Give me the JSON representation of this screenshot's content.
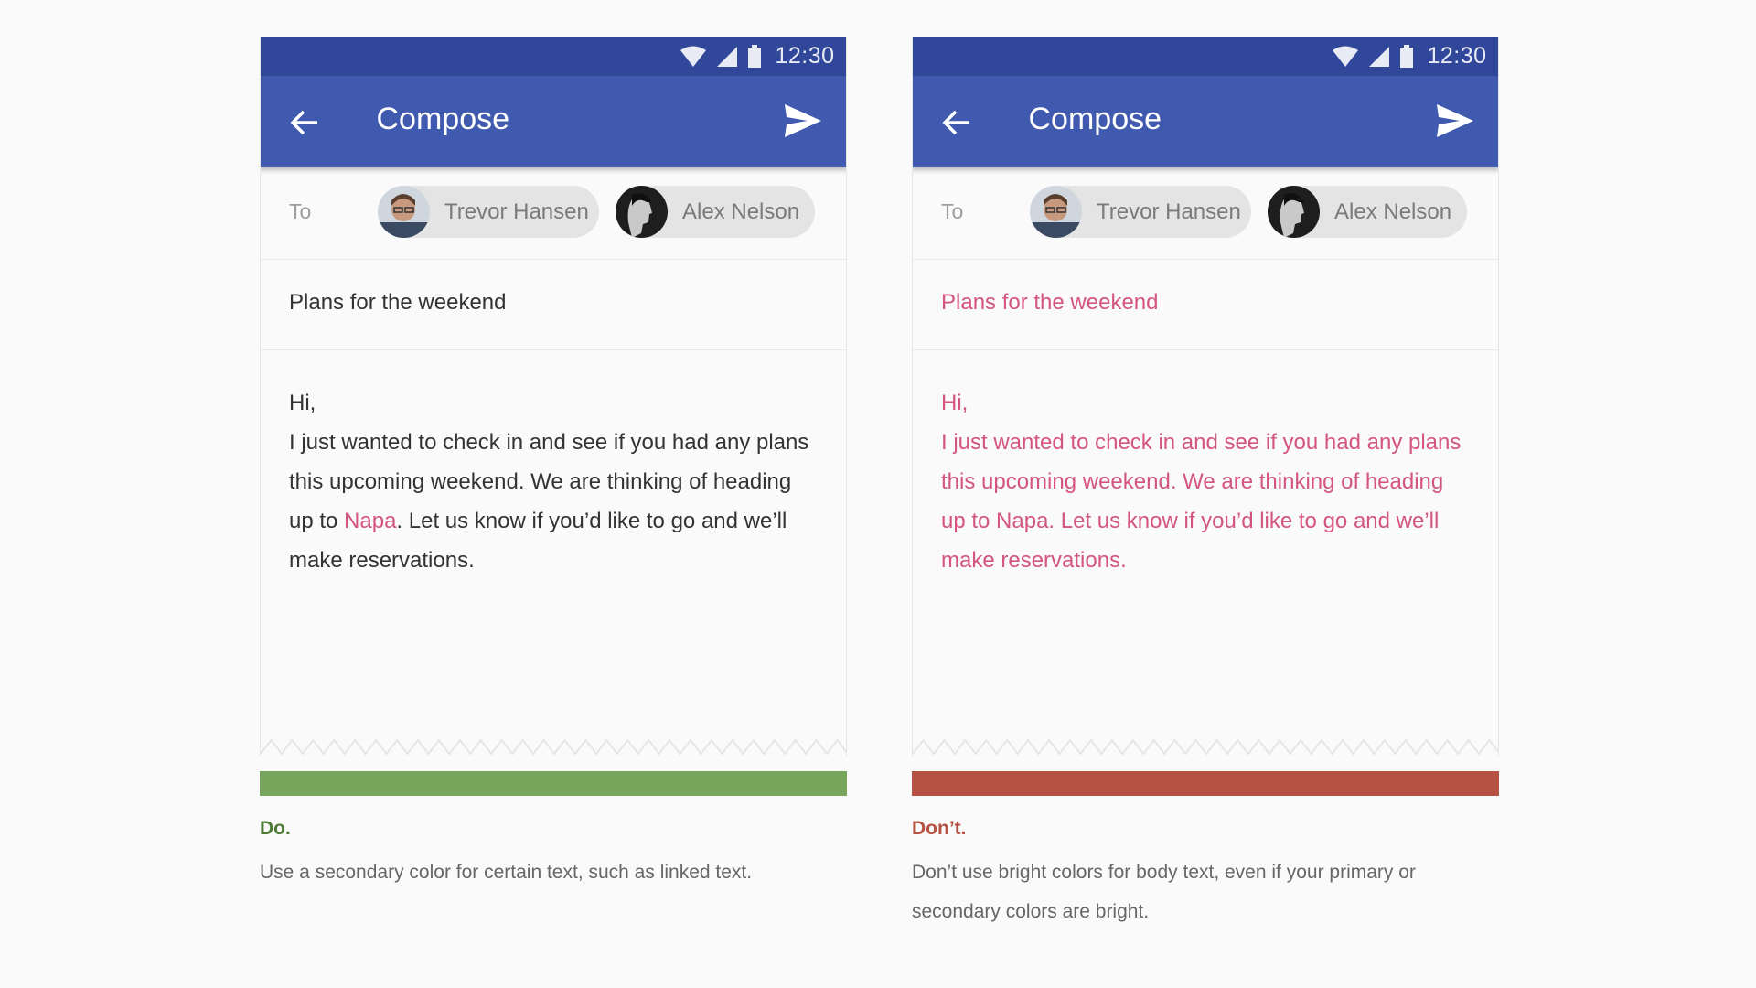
{
  "status_bar": {
    "time": "12:30",
    "icons": [
      "wifi-icon",
      "signal-icon",
      "battery-icon"
    ]
  },
  "app_bar": {
    "title": "Compose",
    "back_icon": "arrow-back-icon",
    "send_icon": "send-icon"
  },
  "compose": {
    "to_label": "To",
    "recipients": [
      {
        "name": "Trevor Hansen"
      },
      {
        "name": "Alex Nelson"
      }
    ],
    "subject": "Plans for the weekend",
    "body": {
      "greeting": "Hi,",
      "before_link": "I just wanted to check in and see if you had any plans this upcoming weekend. We are thinking of heading up to ",
      "link": "Napa",
      "after_link": ". Let us know if you’d like to go and we’ll make reservations."
    }
  },
  "examples": [
    {
      "verdict": "Do.",
      "caption": "Use a secondary color for certain text, such as linked text.",
      "bar_color": "#78a55c",
      "text_color": "#333333",
      "accent_color": "#d4557f"
    },
    {
      "verdict": "Don’t.",
      "caption": "Don’t use bright colors for body text, even if your primary or secondary colors are bright.",
      "bar_color": "#b55244",
      "text_color": "#d4557f",
      "accent_color": "#d4557f"
    }
  ],
  "colors": {
    "status_bar": "#31489a",
    "app_bar": "#3f5aae",
    "chip": "#e4e4e4",
    "background": "#fafafa"
  }
}
